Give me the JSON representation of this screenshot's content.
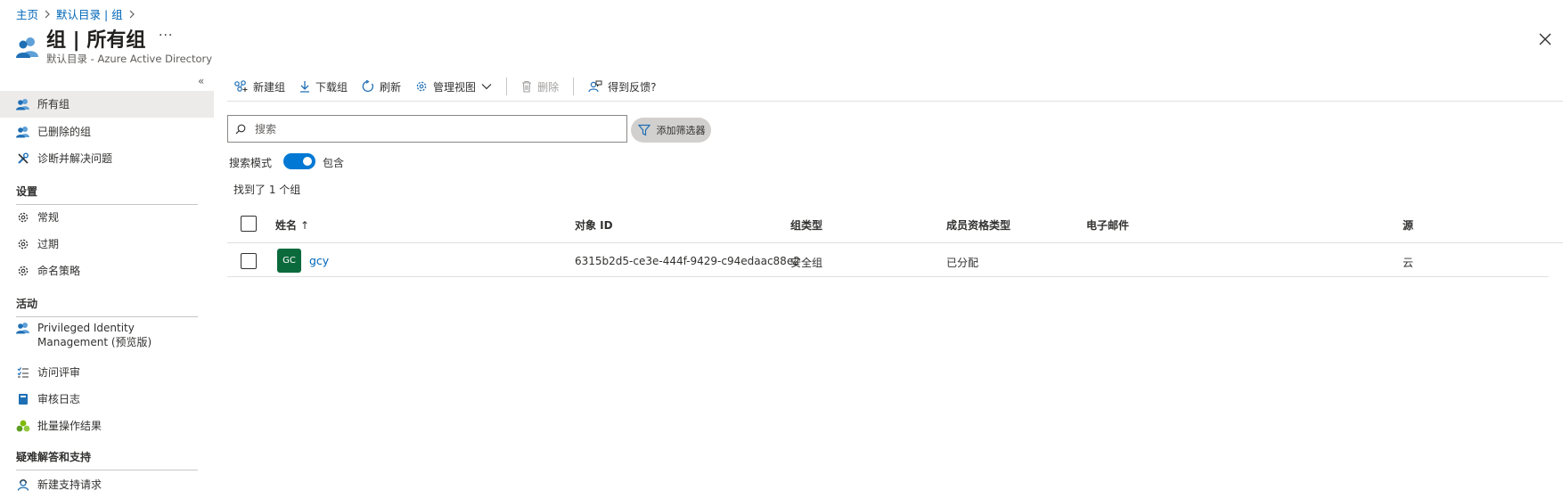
{
  "breadcrumb": {
    "home": "主页",
    "directory": "默认目录 | 组"
  },
  "header": {
    "title": "组 | 所有组",
    "subtitle": "默认目录 - Azure Active Directory",
    "more": "···"
  },
  "sidebar": {
    "collapse": "«",
    "items": [
      {
        "label": "所有组",
        "icon": "group-icon"
      },
      {
        "label": "已删除的组",
        "icon": "group-icon"
      },
      {
        "label": "诊断并解决问题",
        "icon": "wrench-icon"
      }
    ],
    "sections": [
      {
        "title": "设置",
        "items": [
          {
            "label": "常规"
          },
          {
            "label": "过期"
          },
          {
            "label": "命名策略"
          }
        ]
      },
      {
        "title": "活动",
        "items": [
          {
            "label": "Privileged Identity Management (预览版)"
          },
          {
            "label": "访问评审"
          },
          {
            "label": "审核日志"
          },
          {
            "label": "批量操作结果"
          }
        ]
      },
      {
        "title": "疑难解答和支持",
        "items": [
          {
            "label": "新建支持请求"
          }
        ]
      }
    ]
  },
  "toolbar": {
    "new_group": "新建组",
    "download_groups": "下载组",
    "refresh": "刷新",
    "manage_view": "管理视图",
    "delete": "删除",
    "feedback": "得到反馈?"
  },
  "search": {
    "placeholder": "搜索",
    "value": ""
  },
  "filter": {
    "label": "添加筛选器"
  },
  "search_mode": {
    "label": "搜索模式",
    "toggle_label": "包含",
    "enabled": true
  },
  "result_count": "找到了 1 个组",
  "table": {
    "columns": {
      "name": "姓名",
      "object_id": "对象 ID",
      "group_type": "组类型",
      "membership_type": "成员资格类型",
      "email": "电子邮件",
      "source": "源"
    },
    "sort_indicator": "↑",
    "rows": [
      {
        "initials": "GC",
        "name": "gcy",
        "object_id": "6315b2d5-ce3e-444f-9429-c94edaac88e2",
        "group_type": "安全组",
        "membership_type": "已分配",
        "email": "",
        "source": "云"
      }
    ]
  },
  "colors": {
    "accent": "#0078d4",
    "link": "#0066b8",
    "avatar": "#0b6a3c",
    "active_nav": "#edebe9"
  }
}
